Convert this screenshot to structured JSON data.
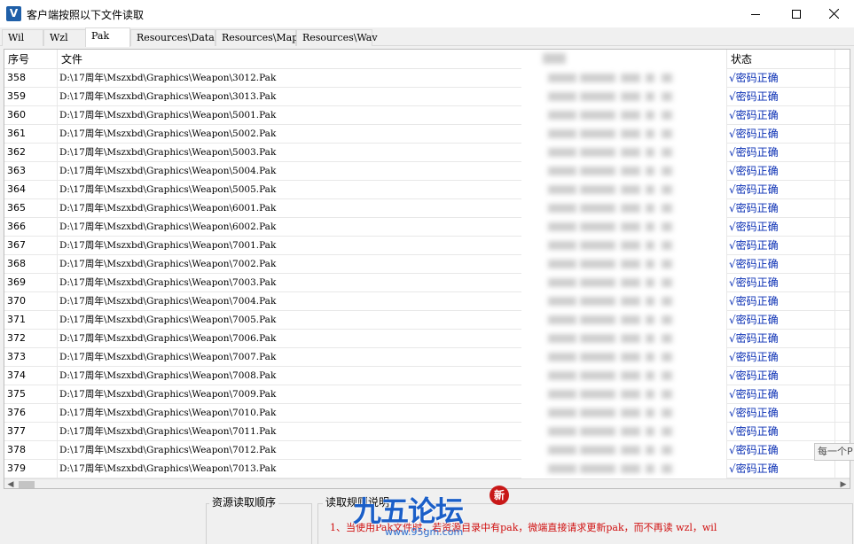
{
  "window": {
    "title": "客户端按照以下文件读取",
    "icon": "app-v-icon",
    "icon_glyph": "V"
  },
  "tabs": [
    {
      "label": "Wil",
      "active": false
    },
    {
      "label": "Wzl",
      "active": false
    },
    {
      "label": "Pak",
      "active": true
    },
    {
      "label": "Resources\\Data",
      "active": false
    },
    {
      "label": "Resources\\Map",
      "active": false
    },
    {
      "label": "Resources\\Wav",
      "active": false
    }
  ],
  "table": {
    "columns": [
      "序号",
      "文件",
      "状态"
    ],
    "status_color": "#0a2fb4",
    "rows": [
      {
        "index": "358",
        "file": "D:\\17周年\\Mszxbd\\Graphics\\Weapon\\3012.Pak",
        "status": "√密码正确"
      },
      {
        "index": "359",
        "file": "D:\\17周年\\Mszxbd\\Graphics\\Weapon\\3013.Pak",
        "status": "√密码正确"
      },
      {
        "index": "360",
        "file": "D:\\17周年\\Mszxbd\\Graphics\\Weapon\\5001.Pak",
        "status": "√密码正确"
      },
      {
        "index": "361",
        "file": "D:\\17周年\\Mszxbd\\Graphics\\Weapon\\5002.Pak",
        "status": "√密码正确"
      },
      {
        "index": "362",
        "file": "D:\\17周年\\Mszxbd\\Graphics\\Weapon\\5003.Pak",
        "status": "√密码正确"
      },
      {
        "index": "363",
        "file": "D:\\17周年\\Mszxbd\\Graphics\\Weapon\\5004.Pak",
        "status": "√密码正确"
      },
      {
        "index": "364",
        "file": "D:\\17周年\\Mszxbd\\Graphics\\Weapon\\5005.Pak",
        "status": "√密码正确"
      },
      {
        "index": "365",
        "file": "D:\\17周年\\Mszxbd\\Graphics\\Weapon\\6001.Pak",
        "status": "√密码正确"
      },
      {
        "index": "366",
        "file": "D:\\17周年\\Mszxbd\\Graphics\\Weapon\\6002.Pak",
        "status": "√密码正确"
      },
      {
        "index": "367",
        "file": "D:\\17周年\\Mszxbd\\Graphics\\Weapon\\7001.Pak",
        "status": "√密码正确"
      },
      {
        "index": "368",
        "file": "D:\\17周年\\Mszxbd\\Graphics\\Weapon\\7002.Pak",
        "status": "√密码正确"
      },
      {
        "index": "369",
        "file": "D:\\17周年\\Mszxbd\\Graphics\\Weapon\\7003.Pak",
        "status": "√密码正确"
      },
      {
        "index": "370",
        "file": "D:\\17周年\\Mszxbd\\Graphics\\Weapon\\7004.Pak",
        "status": "√密码正确"
      },
      {
        "index": "371",
        "file": "D:\\17周年\\Mszxbd\\Graphics\\Weapon\\7005.Pak",
        "status": "√密码正确"
      },
      {
        "index": "372",
        "file": "D:\\17周年\\Mszxbd\\Graphics\\Weapon\\7006.Pak",
        "status": "√密码正确"
      },
      {
        "index": "373",
        "file": "D:\\17周年\\Mszxbd\\Graphics\\Weapon\\7007.Pak",
        "status": "√密码正确"
      },
      {
        "index": "374",
        "file": "D:\\17周年\\Mszxbd\\Graphics\\Weapon\\7008.Pak",
        "status": "√密码正确"
      },
      {
        "index": "375",
        "file": "D:\\17周年\\Mszxbd\\Graphics\\Weapon\\7009.Pak",
        "status": "√密码正确"
      },
      {
        "index": "376",
        "file": "D:\\17周年\\Mszxbd\\Graphics\\Weapon\\7010.Pak",
        "status": "√密码正确"
      },
      {
        "index": "377",
        "file": "D:\\17周年\\Mszxbd\\Graphics\\Weapon\\7011.Pak",
        "status": "√密码正确"
      },
      {
        "index": "378",
        "file": "D:\\17周年\\Mszxbd\\Graphics\\Weapon\\7012.Pak",
        "status": "√密码正确"
      },
      {
        "index": "379",
        "file": "D:\\17周年\\Mszxbd\\Graphics\\Weapon\\7013.Pak",
        "status": "√密码正确"
      }
    ]
  },
  "tooltip": "每一个P",
  "bottom": {
    "group1_title": "资源读取顺序",
    "group2_title": "读取规则说明",
    "note": "1、当使用Pak文件时，若资源目录中有pak，微端直接请求更新pak，而不再读 wzl，wil"
  },
  "watermark": {
    "text": "九五论坛",
    "url": "www.95gm.com",
    "seal": "新"
  }
}
